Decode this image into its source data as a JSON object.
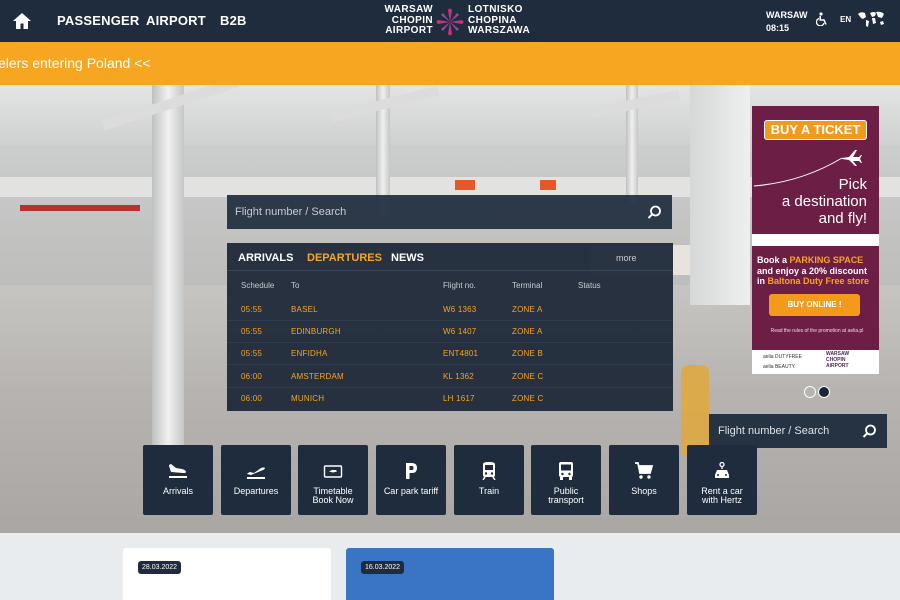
{
  "nav": {
    "items": [
      "PASSENGER",
      "AIRPORT",
      "B2B"
    ],
    "logo_left": [
      "WARSAW",
      "CHOPIN",
      "AIRPORT"
    ],
    "logo_right": [
      "LOTNISKO",
      "CHOPINA",
      "WARSZAWA"
    ],
    "city": "WARSAW",
    "time": "08:15",
    "lang": "EN"
  },
  "ticker": {
    "text": "elers entering Poland <<"
  },
  "flight_search": {
    "placeholder": "Flight number / Search"
  },
  "board": {
    "tabs": [
      "ARRIVALS",
      "DEPARTURES",
      "NEWS"
    ],
    "active_tab": "DEPARTURES",
    "more": "more",
    "headers": {
      "schedule": "Schedule",
      "to": "To",
      "flight": "Flight no.",
      "terminal": "Terminal",
      "status": "Status"
    },
    "rows": [
      {
        "time": "05:55",
        "to": "BASEL",
        "flight": "W6 1363",
        "terminal": "ZONE A",
        "status": ""
      },
      {
        "time": "05:55",
        "to": "EDINBURGH",
        "flight": "W6 1407",
        "terminal": "ZONE A",
        "status": ""
      },
      {
        "time": "05:55",
        "to": "ENFIDHA",
        "flight": "ENT4801",
        "terminal": "ZONE B",
        "status": ""
      },
      {
        "time": "06:00",
        "to": "AMSTERDAM",
        "flight": "KL 1362",
        "terminal": "ZONE C",
        "status": ""
      },
      {
        "time": "06:00",
        "to": "MUNICH",
        "flight": "LH 1617",
        "terminal": "ZONE C",
        "status": ""
      }
    ]
  },
  "promo": {
    "buy_ticket": "BUY A TICKET",
    "pick": [
      "Pick",
      "a destination",
      "and fly!"
    ],
    "parking_line1_a": "Book a ",
    "parking_line1_b": "PARKING SPACE",
    "parking_line2": "and enjoy a 20% discount",
    "parking_line3_a": "in ",
    "parking_line3_b": "Baltona Duty Free store",
    "buy_online": "BUY ONLINE !",
    "rules": "Read the rules of the promotion at aelia.pl",
    "brand1": "aelia DUTYFREE",
    "brand2": "aelia BEAUTY",
    "brand3": "WARSAW CHOPIN AIRPORT"
  },
  "search2": {
    "placeholder": "Flight number / Search"
  },
  "tiles": [
    {
      "label": "Arrivals",
      "icon": "arrivals-plane-icon"
    },
    {
      "label": "Departures",
      "icon": "departures-plane-icon"
    },
    {
      "label": "Timetable Book Now",
      "icon": "ticket-icon"
    },
    {
      "label": "Car park tariff",
      "icon": "parking-icon"
    },
    {
      "label": "Train",
      "icon": "train-icon"
    },
    {
      "label": "Public transport",
      "icon": "bus-icon"
    },
    {
      "label": "Shops",
      "icon": "cart-icon"
    },
    {
      "label": "Rent a car with Hertz",
      "icon": "car-key-icon"
    }
  ],
  "tile_labels": {
    "t0": "Arrivals",
    "t1": "Departures",
    "t2a": "Timetable",
    "t2b": "Book Now",
    "t3": "Car park tariff",
    "t4": "Train",
    "t5a": "Public",
    "t5b": "transport",
    "t6": "Shops",
    "t7a": "Rent a car",
    "t7b": "with Hertz"
  },
  "news": [
    {
      "date": "28.03.2022"
    },
    {
      "date": "16.03.2022"
    }
  ],
  "colors": {
    "navy": "#1f2c3d",
    "orange": "#f7a621",
    "promo_purple": "#6d1e44",
    "news_blue": "#3a74c4"
  }
}
